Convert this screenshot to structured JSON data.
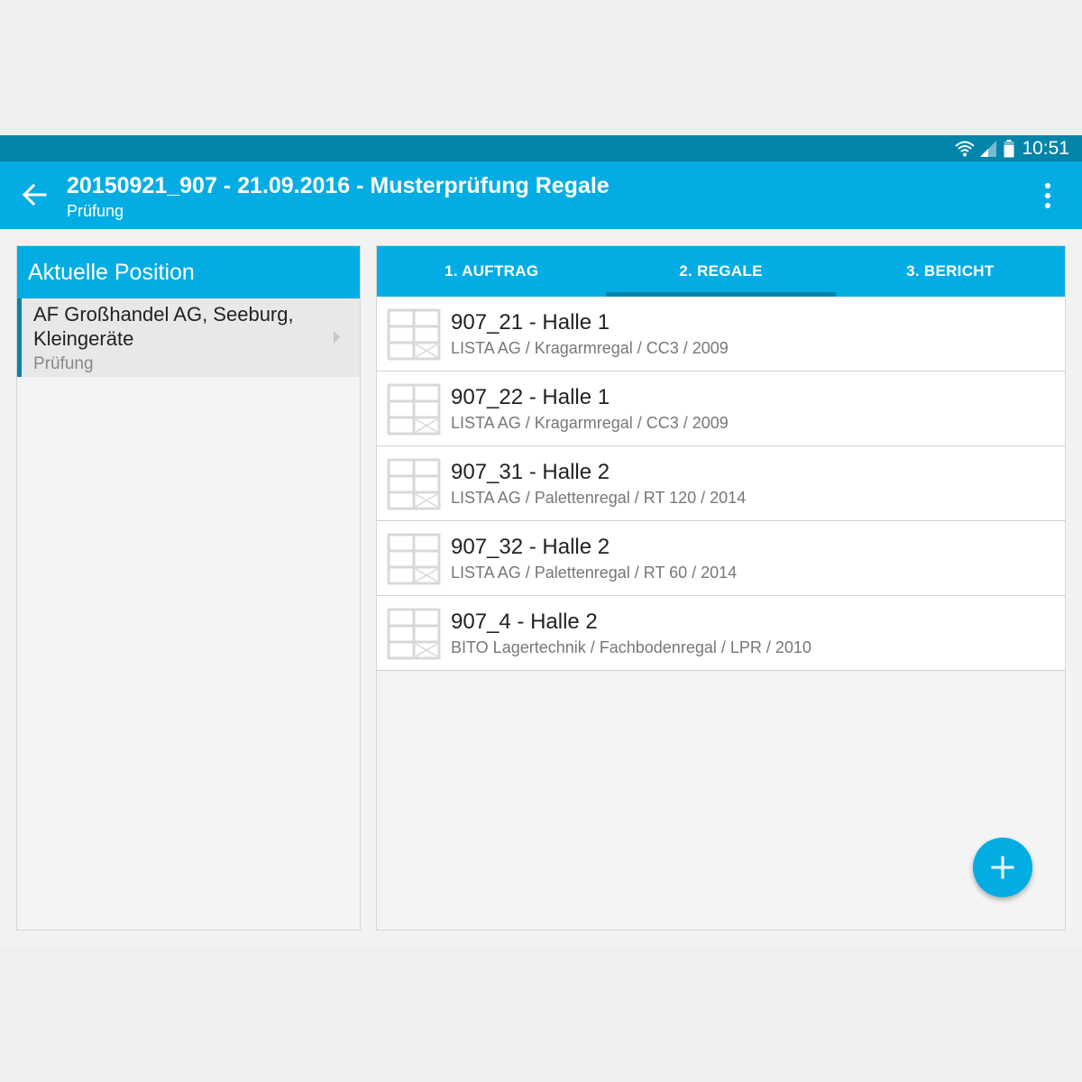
{
  "status_bar": {
    "time": "10:51"
  },
  "app_bar": {
    "title": "20150921_907 - 21.09.2016 - Musterprüfung Regale",
    "subtitle": "Prüfung"
  },
  "left_panel": {
    "header": "Aktuelle Position",
    "item": {
      "title": "AF Großhandel AG, Seeburg, Kleingeräte",
      "subtitle": "Prüfung"
    }
  },
  "tabs": [
    {
      "label": "1. AUFTRAG",
      "active": false
    },
    {
      "label": "2. REGALE",
      "active": true
    },
    {
      "label": "3. BERICHT",
      "active": false
    }
  ],
  "list": [
    {
      "title": "907_21 - Halle 1",
      "subtitle": "LISTA AG / Kragarmregal / CC3 / 2009",
      "icon": "shelf-icon"
    },
    {
      "title": "907_22 - Halle 1",
      "subtitle": "LISTA AG / Kragarmregal / CC3 / 2009",
      "icon": "shelf-icon"
    },
    {
      "title": "907_31 - Halle 2",
      "subtitle": "LISTA AG / Palettenregal / RT 120 / 2014",
      "icon": "shelf-icon"
    },
    {
      "title": "907_32 - Halle 2",
      "subtitle": "LISTA AG / Palettenregal / RT 60 / 2014",
      "icon": "shelf-icon"
    },
    {
      "title": "907_4 - Halle 2",
      "subtitle": "BITO Lagertechnik / Fachbodenregal / LPR / 2010",
      "icon": "shelf-icon"
    }
  ],
  "colors": {
    "primary": "#03ade3",
    "primary_dark": "#0384a9",
    "background": "#f2f2f2"
  },
  "icons": [
    "wifi-icon",
    "signal-icon",
    "battery-icon",
    "back-arrow-icon",
    "overflow-menu-icon",
    "chevron-right-icon",
    "add-icon"
  ]
}
